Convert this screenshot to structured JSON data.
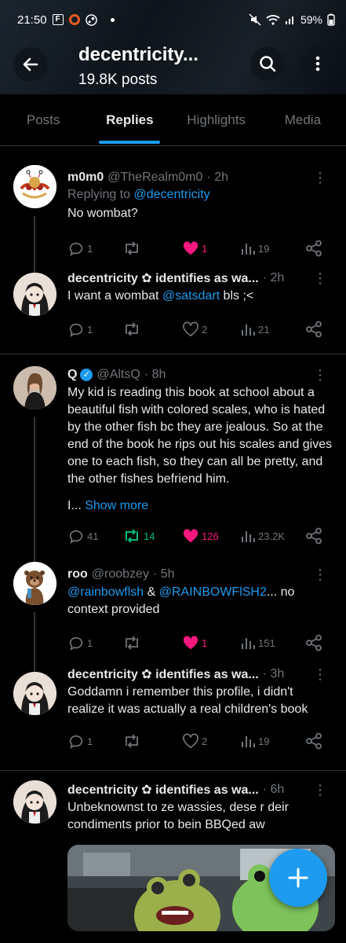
{
  "status": {
    "time": "21:50",
    "battery": "59%"
  },
  "header": {
    "title": "decentricity...",
    "subtitle": "19.8K posts"
  },
  "tabs": [
    {
      "label": "Posts"
    },
    {
      "label": "Replies"
    },
    {
      "label": "Highlights"
    },
    {
      "label": "Media"
    }
  ],
  "posts": [
    {
      "name": "m0m0",
      "handle": "@TheRealm0m0",
      "time": "· 2h",
      "replying_prefix": "Replying to ",
      "replying_to": "@decentricity",
      "text": "No wombat?",
      "replies": "1",
      "reposts": "",
      "likes": "1",
      "views": "19"
    },
    {
      "name": "decentricity ✿ identifies as wa...",
      "handle": "",
      "time": "· 2h",
      "text_before": "I want a wombat ",
      "mention": "@satsdart",
      "text_after": " bls ;<",
      "replies": "1",
      "reposts": "",
      "likes": "2",
      "views": "21"
    },
    {
      "name": "Q",
      "handle": "@AltsQ",
      "time": "· 8h",
      "text": "My kid is reading this book at school about a beautiful fish with colored scales, who is hated by the other fish bc they are jealous. So at the end of the book he rips out his scales and gives one to each fish, so they can all be pretty, and the other fishes befriend him.",
      "truncation": "I... ",
      "show_more": "Show more",
      "replies": "41",
      "reposts": "14",
      "likes": "126",
      "views": "23.2K"
    },
    {
      "name": "roo",
      "handle": "@roobzey",
      "time": "· 5h",
      "mention1": "@rainbowflsh",
      "amp": " & ",
      "mention2": "@RAINBOWFlSH2",
      "text_after": "... no context provided",
      "replies": "1",
      "reposts": "",
      "likes": "1",
      "views": "151"
    },
    {
      "name": "decentricity ✿ identifies as wa...",
      "handle": "",
      "time": "· 3h",
      "text": "Goddamn i remember this profile, i didn't realize it was actually a real children's book",
      "replies": "1",
      "reposts": "",
      "likes": "2",
      "views": "19"
    },
    {
      "name": "decentricity ✿ identifies as wa...",
      "handle": "",
      "time": "· 6h",
      "text": "Unbeknownst to ze wassies, dese r deir condiments prior to bein BBQed aw"
    }
  ],
  "colors": {
    "accent": "#1d9bf0",
    "like": "#f91880",
    "repost": "#00ba7c",
    "muted": "#71767b"
  },
  "icons": {
    "fab": "plus-icon"
  }
}
